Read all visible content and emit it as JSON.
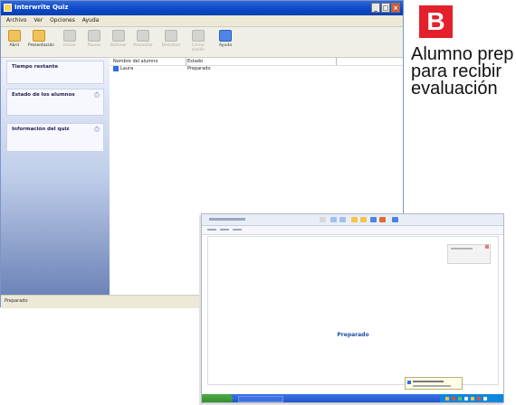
{
  "window": {
    "title": "Interwrite Quiz",
    "controls": [
      "_",
      "□",
      "×"
    ]
  },
  "menu": [
    "Archivo",
    "Ver",
    "Opciones",
    "Ayuda"
  ],
  "toolbar": [
    {
      "label": "Abrir",
      "icon": "open-folder-icon",
      "state": "active"
    },
    {
      "label": "Presentación",
      "icon": "presentation-icon",
      "state": "active"
    },
    {
      "label": "Iniciar",
      "icon": "start-icon",
      "state": "disabled"
    },
    {
      "label": "Pausar",
      "icon": "pause-icon",
      "state": "disabled"
    },
    {
      "label": "Detener",
      "icon": "stop-icon",
      "state": "disabled"
    },
    {
      "label": "Presentar",
      "icon": "present-icon",
      "state": "disabled"
    },
    {
      "label": "Distribuir",
      "icon": "distribute-icon",
      "state": "disabled"
    },
    {
      "label": "Cerrar sesión",
      "icon": "logout-icon",
      "state": "disabled"
    },
    {
      "label": "Ayuda",
      "icon": "help-icon",
      "state": "blue"
    }
  ],
  "panels": [
    {
      "header": "Tiempo restante"
    },
    {
      "header": "Estado de los alumnos"
    },
    {
      "header": "Información del quiz"
    }
  ],
  "list": {
    "columns": [
      "Nombre del alumno",
      "Estado"
    ],
    "rows": [
      {
        "name": "Laura",
        "status": "Preparado"
      }
    ]
  },
  "statusbar": "Preparado",
  "badge": "B",
  "caption": [
    "Alumno prep",
    "para recibir",
    "evaluación"
  ],
  "screen2": {
    "status": "Preparado"
  },
  "colors": {
    "accent": "#0b46c6",
    "badge": "#e4202b",
    "status_text": "#1d4fa5"
  }
}
